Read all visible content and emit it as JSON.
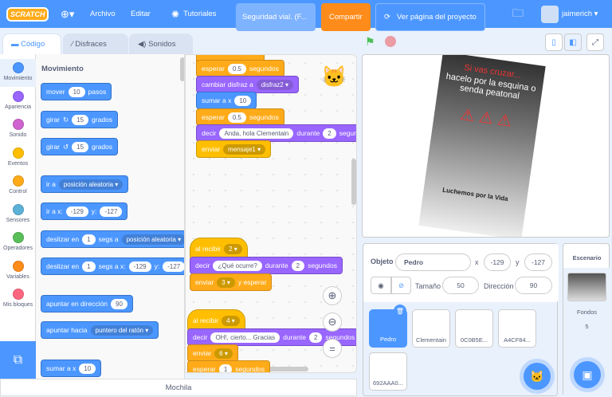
{
  "topbar": {
    "logo": "SCRATCH",
    "archivo": "Archivo",
    "editar": "Editar",
    "tutoriales": "Tutoriales",
    "title": "Seguridad vial. (F...",
    "share": "Compartir",
    "view": "Ver página del proyecto",
    "user": "jaimerich"
  },
  "tabs": [
    "Código",
    "Disfraces",
    "Sonidos"
  ],
  "categories": [
    {
      "label": "Movimiento",
      "color": "#4c97ff"
    },
    {
      "label": "Apariencia",
      "color": "#9966ff"
    },
    {
      "label": "Sonido",
      "color": "#cf63cf"
    },
    {
      "label": "Eventos",
      "color": "#ffbf00"
    },
    {
      "label": "Control",
      "color": "#ffab19"
    },
    {
      "label": "Sensores",
      "color": "#5cb1d6"
    },
    {
      "label": "Operadores",
      "color": "#59c059"
    },
    {
      "label": "Variables",
      "color": "#ff8c1a"
    },
    {
      "label": "Mis bloques",
      "color": "#ff6680"
    }
  ],
  "palette": {
    "heading": "Movimiento",
    "mover": [
      "mover",
      "10",
      "pasos"
    ],
    "girar_r": [
      "girar",
      "15",
      "grados"
    ],
    "girar_l": [
      "girar",
      "15",
      "grados"
    ],
    "ir_a": [
      "ir a",
      "posición aleatoria"
    ],
    "ir_xy": [
      "ir a x:",
      "-129",
      "y:",
      "-127"
    ],
    "deslizar1": [
      "deslizar en",
      "1",
      "segs a",
      "posición aleatoria"
    ],
    "deslizar2": [
      "deslizar en",
      "1",
      "segs a x:",
      "-129",
      "y:",
      "-127"
    ],
    "apuntar_dir": [
      "apuntar en dirección",
      "90"
    ],
    "apuntar_hacia": [
      "apuntar hacia",
      "puntero del ratón"
    ],
    "sumar": [
      "sumar a x",
      "10"
    ]
  },
  "script": {
    "s1": [
      "esperar",
      "0.5",
      "segundos"
    ],
    "s2": [
      "cambiar disfraz a",
      "disfraz2"
    ],
    "s3": [
      "sumar a x",
      "10"
    ],
    "s4": [
      "esperar",
      "0.5",
      "segundos"
    ],
    "s5": [
      "decir",
      "Anda, hola Clementain",
      "durante",
      "2",
      "segundos"
    ],
    "s6": [
      "enviar",
      "mensaje1"
    ],
    "h2": [
      "al recibir",
      "2"
    ],
    "h2a": [
      "decir",
      "¿Qué ocurre?",
      "durante",
      "2",
      "segundos"
    ],
    "h2b": [
      "enviar",
      "3",
      "y esperar"
    ],
    "h4": [
      "al recibir",
      "4"
    ],
    "h4a": [
      "decir",
      "OH!, cierto... Gracias",
      "durante",
      "2",
      "segundos"
    ],
    "h4b": [
      "enviar",
      "6"
    ],
    "h4c": [
      "esperar",
      "1",
      "segundos"
    ]
  },
  "mochila": "Mochila",
  "poster": {
    "l1": "Si vas cruzar...",
    "l2": "hacelo por la esquina o senda peatonal",
    "logo": "Luchemos por la Vida"
  },
  "sprite_info": {
    "objeto_label": "Objeto",
    "name": "Pedro",
    "x_label": "x",
    "x": "-129",
    "y_label": "y",
    "y": "-127",
    "size_label": "Tamaño",
    "size": "50",
    "dir_label": "Dirección",
    "dir": "90"
  },
  "sprites": [
    "Pedro",
    "Clementain",
    "0C0B5E...",
    "A4CF84...",
    "692AAA0..."
  ],
  "stage_panel": {
    "title": "Escenario",
    "fondos_label": "Fondos",
    "fondos": "5"
  }
}
